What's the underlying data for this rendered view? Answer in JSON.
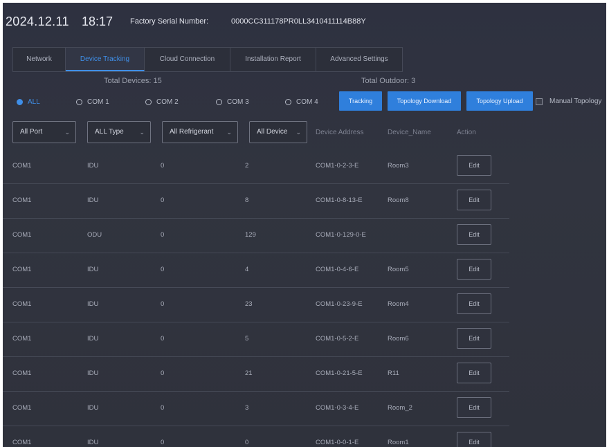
{
  "header": {
    "date": "2024.12.11",
    "time": "18:17",
    "serial_label": "Factory Serial Number:",
    "serial_value": "0000CC311178PR0LL3410411114B88Y"
  },
  "tabs": [
    {
      "label": "Network",
      "active": false
    },
    {
      "label": "Device Tracking",
      "active": true
    },
    {
      "label": "Cloud Connection",
      "active": false
    },
    {
      "label": "Installation Report",
      "active": false
    },
    {
      "label": "Advanced Settings",
      "active": false
    }
  ],
  "totals": {
    "devices": "Total Devices: 15",
    "outdoor": "Total Outdoor: 3"
  },
  "ports": [
    {
      "label": "ALL",
      "checked": true
    },
    {
      "label": "COM 1",
      "checked": false
    },
    {
      "label": "COM 2",
      "checked": false
    },
    {
      "label": "COM 3",
      "checked": false
    },
    {
      "label": "COM 4",
      "checked": false
    }
  ],
  "buttons": {
    "tracking": "Tracking",
    "topology_download": "Topology Download",
    "topology_upload": "Topology Upload"
  },
  "manual_topology": {
    "label": "Manual Topology",
    "checked": false
  },
  "filters": {
    "port": "All Port",
    "type": "ALL Type",
    "refrigerant": "All Refrigerant",
    "device": "All Device"
  },
  "columns": {
    "device_address": "Device Address",
    "device_name": "Device_Name",
    "action": "Action"
  },
  "rows": [
    {
      "port": "COM1",
      "type": "IDU",
      "refrigerant": "0",
      "device": "2",
      "address": "COM1-0-2-3-E",
      "name": "Room3",
      "action": "Edit"
    },
    {
      "port": "COM1",
      "type": "IDU",
      "refrigerant": "0",
      "device": "8",
      "address": "COM1-0-8-13-E",
      "name": "Room8",
      "action": "Edit"
    },
    {
      "port": "COM1",
      "type": "ODU",
      "refrigerant": "0",
      "device": "129",
      "address": "COM1-0-129-0-E",
      "name": "",
      "action": "Edit"
    },
    {
      "port": "COM1",
      "type": "IDU",
      "refrigerant": "0",
      "device": "4",
      "address": "COM1-0-4-6-E",
      "name": "Room5",
      "action": "Edit"
    },
    {
      "port": "COM1",
      "type": "IDU",
      "refrigerant": "0",
      "device": "23",
      "address": "COM1-0-23-9-E",
      "name": "Room4",
      "action": "Edit"
    },
    {
      "port": "COM1",
      "type": "IDU",
      "refrigerant": "0",
      "device": "5",
      "address": "COM1-0-5-2-E",
      "name": "Room6",
      "action": "Edit"
    },
    {
      "port": "COM1",
      "type": "IDU",
      "refrigerant": "0",
      "device": "21",
      "address": "COM1-0-21-5-E",
      "name": "R11",
      "action": "Edit"
    },
    {
      "port": "COM1",
      "type": "IDU",
      "refrigerant": "0",
      "device": "3",
      "address": "COM1-0-3-4-E",
      "name": "Room_2",
      "action": "Edit"
    },
    {
      "port": "COM1",
      "type": "IDU",
      "refrigerant": "0",
      "device": "0",
      "address": "COM1-0-0-1-E",
      "name": "Room1",
      "action": "Edit"
    }
  ],
  "colors": {
    "accent": "#3f8fe8",
    "button": "#2f7fdc",
    "background": "#30333e"
  },
  "icons": [
    "radio-checked-icon",
    "radio-unchecked-icon",
    "chevron-down-icon",
    "checkbox-icon"
  ]
}
